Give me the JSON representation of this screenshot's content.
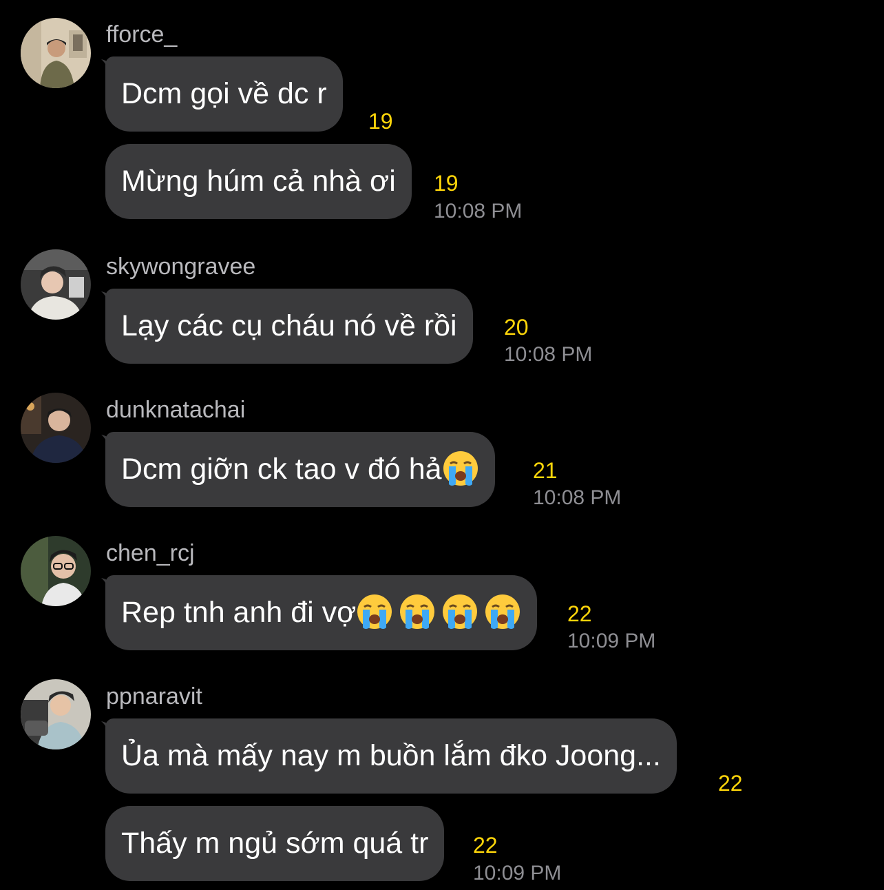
{
  "messages": {
    "group1": {
      "username": "fforce_",
      "m1": {
        "text": "Dcm gọi về dc r",
        "count": "19"
      },
      "m2": {
        "text": "Mừng húm cả nhà ơi",
        "count": "19",
        "time": "10:08 PM"
      }
    },
    "group2": {
      "username": "skywongravee",
      "m1": {
        "text": "Lạy các cụ cháu nó về rồi",
        "count": "20",
        "time": "10:08 PM"
      }
    },
    "group3": {
      "username": "dunknatachai",
      "m1": {
        "text": "Dcm giỡn ck tao v đó hả",
        "count": "21",
        "time": "10:08 PM"
      }
    },
    "group4": {
      "username": "chen_rcj",
      "m1": {
        "text": "Rep tnh anh đi vợ",
        "count": "22",
        "time": "10:09 PM"
      }
    },
    "group5": {
      "username": "ppnaravit",
      "m1": {
        "text": "Ủa mà mấy nay m buồn lắm đko Joong...",
        "count": "22"
      },
      "m2": {
        "text": "Thấy m ngủ sớm quá tr",
        "count": "22",
        "time": "10:09 PM"
      }
    }
  },
  "icons": {
    "avatar": "profile-photo",
    "emoji": "loudly-crying-face"
  },
  "colors": {
    "background": "#000000",
    "bubble": "#3a3a3c",
    "username": "#b9b9bd",
    "count": "#ffd60a",
    "time": "#8e8e93"
  }
}
